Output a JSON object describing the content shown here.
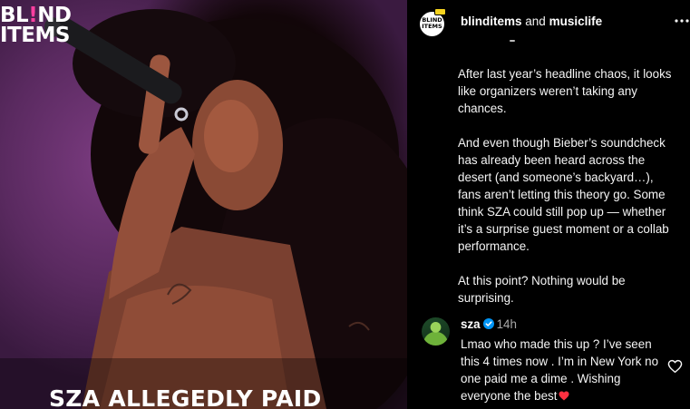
{
  "post": {
    "logo": {
      "line1_a": "BL",
      "line1_bang": "!",
      "line1_b": "ND",
      "line2": "ITEMS"
    },
    "headline": "SZA ALLEGEDLY PAID"
  },
  "header": {
    "account_1": "blinditems",
    "joiner": "and",
    "account_2": "musiclife",
    "avatar_text": "BLIND ITEMS"
  },
  "caption": {
    "paragraphs": [
      "After last year’s headline chaos, it looks like organizers weren’t taking any chances.",
      "And even though Bieber’s soundcheck has already been heard across the desert (and someone’s backyard…), fans aren’t letting this theory go. Some think SZA could still pop up — whether it’s a surprise guest moment or a collab performance.",
      "At this point? Nothing would be surprising."
    ]
  },
  "comment": {
    "username": "sza",
    "time": "14h",
    "text": "Lmao who made this up ? I’ve seen this 4 times now . I’m in New York no one paid me a dime . Wishing everyone the best"
  },
  "icons": {
    "more": "more-options-icon",
    "verified": "verified-badge-icon",
    "heart": "red-heart-icon",
    "like": "heart-outline-icon"
  },
  "colors": {
    "background": "#000000",
    "text": "#f5f5f5",
    "muted": "#a8a8a8",
    "verified": "#0095f6",
    "heart": "#ff3040",
    "logo_accent": "#ff3fa0",
    "badge": "#f6d31f"
  }
}
